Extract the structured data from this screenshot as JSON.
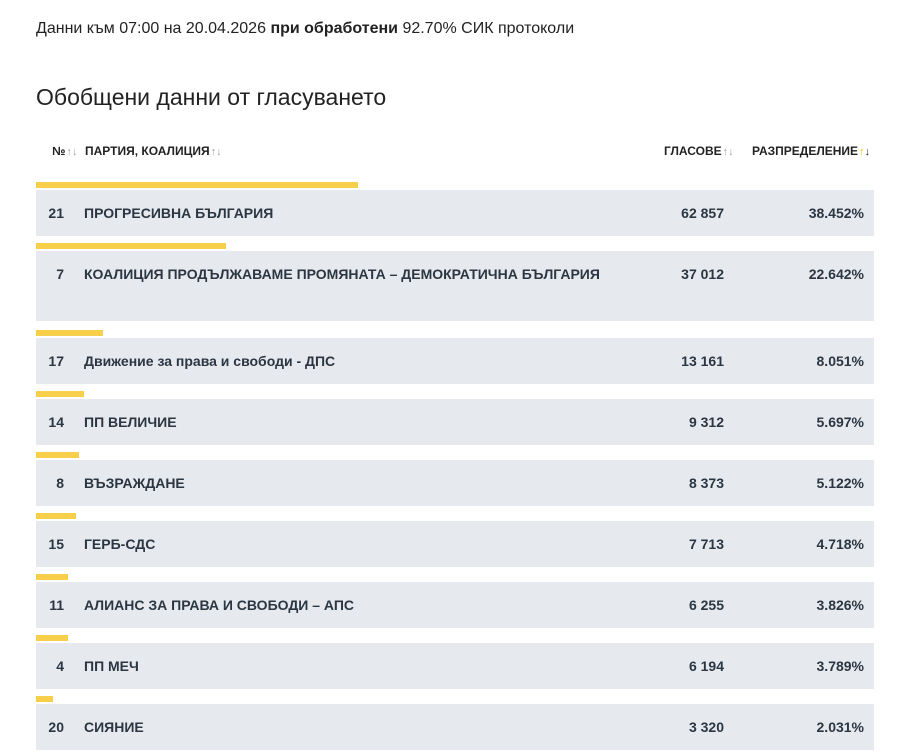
{
  "status": {
    "prefix": "Данни към 07:00 на 20.04.2026",
    "bold": "при обработени",
    "suffix": "92.70% СИК протоколи"
  },
  "section_title": "Обобщени данни от гласуването",
  "table_headers": {
    "num": "№",
    "party": "ПАРТИЯ, КОАЛИЦИЯ",
    "votes": "ГЛАСОВЕ",
    "share": "РАЗПРЕДЕЛЕНИЕ",
    "sort_glyph": "↑↓"
  },
  "chart_data": {
    "type": "bar",
    "orientation": "horizontal",
    "columns": [
      "№",
      "ПАРТИЯ, КОАЛИЦИЯ",
      "ГЛАСОВЕ",
      "РАЗПРЕДЕЛЕНИЕ"
    ],
    "rows": [
      {
        "num": "21",
        "party": "ПРОГРЕСИВНА БЪЛГАРИЯ",
        "votes": "62 857",
        "votes_value": 62857,
        "share": "38.452%",
        "share_value": 38.452
      },
      {
        "num": "7",
        "party": "КОАЛИЦИЯ ПРОДЪЛЖАВАМЕ ПРОМЯНАТА – ДЕМОКРАТИЧНА БЪЛГАРИЯ",
        "votes": "37 012",
        "votes_value": 37012,
        "share": "22.642%",
        "share_value": 22.642
      },
      {
        "num": "17",
        "party": "Движение за права и свободи - ДПС",
        "votes": "13 161",
        "votes_value": 13161,
        "share": "8.051%",
        "share_value": 8.051
      },
      {
        "num": "14",
        "party": "ПП ВЕЛИЧИЕ",
        "votes": "9 312",
        "votes_value": 9312,
        "share": "5.697%",
        "share_value": 5.697
      },
      {
        "num": "8",
        "party": "ВЪЗРАЖДАНЕ",
        "votes": "8 373",
        "votes_value": 8373,
        "share": "5.122%",
        "share_value": 5.122
      },
      {
        "num": "15",
        "party": "ГЕРБ-СДС",
        "votes": "7 713",
        "votes_value": 7713,
        "share": "4.718%",
        "share_value": 4.718
      },
      {
        "num": "11",
        "party": "АЛИАНС ЗА ПРАВА И СВОБОДИ – АПС",
        "votes": "6 255",
        "votes_value": 6255,
        "share": "3.826%",
        "share_value": 3.826
      },
      {
        "num": "4",
        "party": "ПП МЕЧ",
        "votes": "6 194",
        "votes_value": 6194,
        "share": "3.789%",
        "share_value": 3.789
      },
      {
        "num": "20",
        "party": "СИЯНИЕ",
        "votes": "3 320",
        "votes_value": 3320,
        "share": "2.031%",
        "share_value": 2.031
      }
    ],
    "bar_color": "#f7cf4a",
    "row_background": "#e6eaee"
  }
}
